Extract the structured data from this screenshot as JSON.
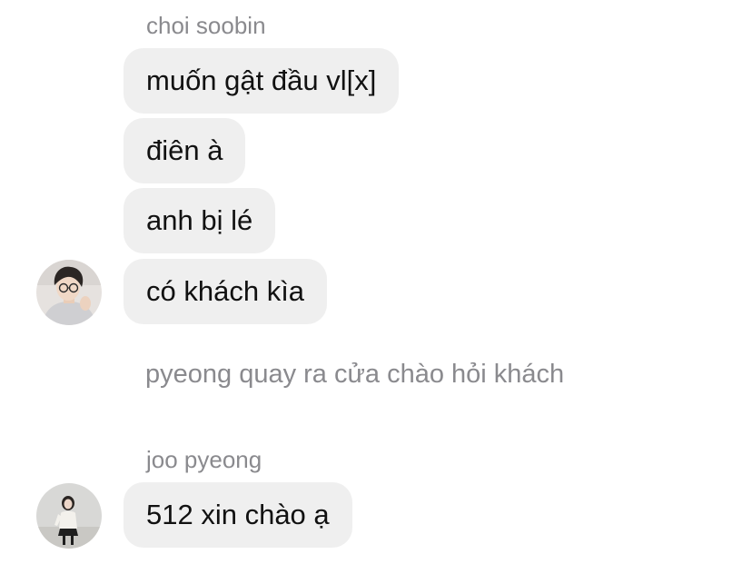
{
  "thread": {
    "group1": {
      "sender": "choi soobin",
      "avatar_icon": "profile-photo-boy-glasses",
      "messages": [
        "muốn gật đầu vl[x]",
        "điên à",
        "anh bị lé",
        "có khách kìa"
      ]
    },
    "narration": "pyeong quay ra cửa chào hỏi khách",
    "group2": {
      "sender": "joo pyeong",
      "avatar_icon": "profile-photo-girl",
      "messages": [
        "512 xin chào ạ"
      ]
    }
  },
  "colors": {
    "bubble_bg": "#efefef",
    "meta_text": "#8a8a8e",
    "message_text": "#111111"
  }
}
